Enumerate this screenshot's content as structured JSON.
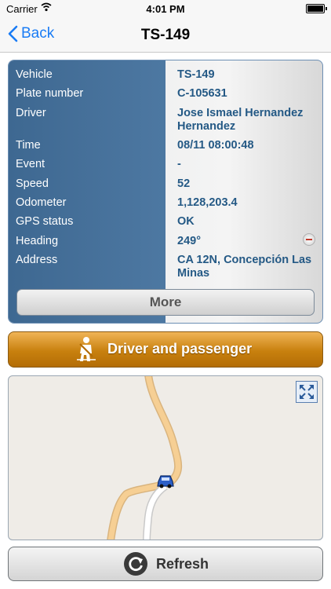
{
  "status_bar": {
    "carrier": "Carrier",
    "time": "4:01 PM"
  },
  "nav": {
    "back_label": "Back",
    "title": "TS-149"
  },
  "details": [
    {
      "key": "Vehicle",
      "value": "TS-149"
    },
    {
      "key": "Plate number",
      "value": "C-105631"
    },
    {
      "key": "Driver",
      "value": "Jose Ismael Hernandez Hernandez"
    },
    {
      "key": "Time",
      "value": "08/11 08:00:48"
    },
    {
      "key": "Event",
      "value": "-"
    },
    {
      "key": "Speed",
      "value": "52"
    },
    {
      "key": "Odometer",
      "value": "1,128,203.4"
    },
    {
      "key": "GPS status",
      "value": "OK"
    },
    {
      "key": "Heading",
      "value": "249°"
    },
    {
      "key": "Address",
      "value": "CA 12N, Concepción Las Minas"
    }
  ],
  "more_label": "More",
  "seatbelt_label": "Driver and passenger",
  "refresh_label": "Refresh",
  "icons": [
    "back-chevron",
    "wifi",
    "battery",
    "heading-compass",
    "seatbelt",
    "expand",
    "car",
    "refresh"
  ]
}
